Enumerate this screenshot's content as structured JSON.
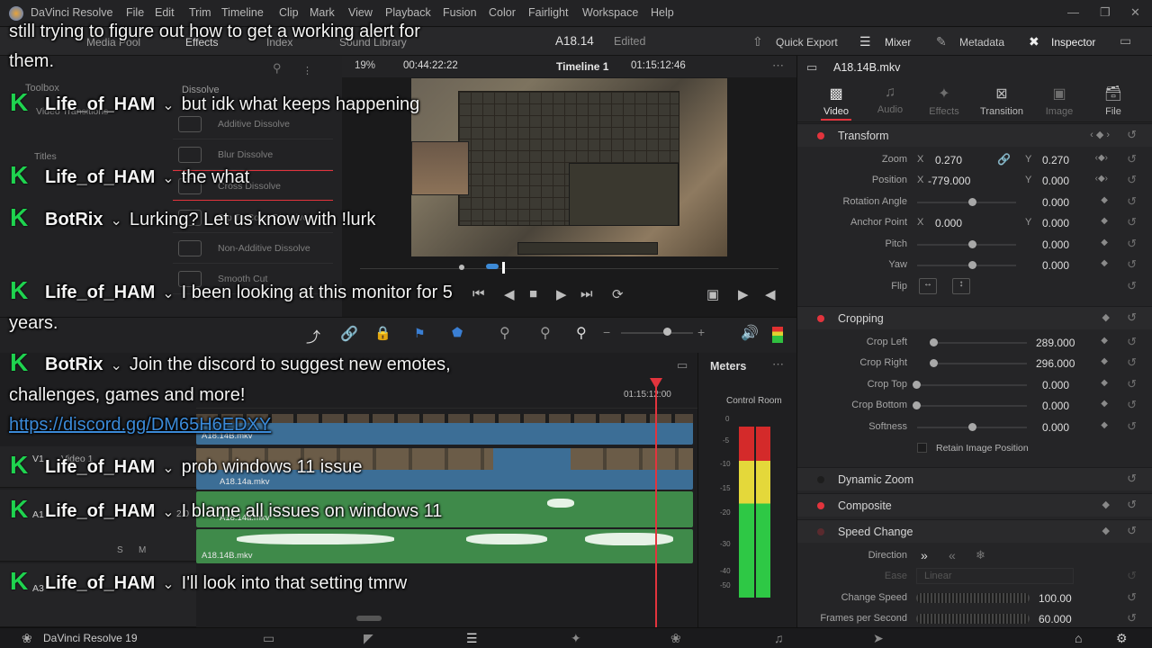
{
  "menu": [
    "DaVinci Resolve",
    "File",
    "Edit",
    "Trim",
    "Timeline",
    "Clip",
    "Mark",
    "View",
    "Playback",
    "Fusion",
    "Color",
    "Fairlight",
    "Workspace",
    "Help"
  ],
  "toolbar": {
    "media_pool": "Media Pool",
    "effects": "Effects",
    "index": "Index",
    "sound_library": "Sound Library",
    "project_name": "A18.14",
    "edited": "Edited",
    "quick_export": "Quick Export",
    "mixer": "Mixer",
    "metadata": "Metadata",
    "inspector": "Inspector"
  },
  "viewer": {
    "zoom": "19%",
    "timecode_left": "00:44:22:22",
    "timeline_name": "Timeline 1",
    "timecode_right": "01:15:12:46",
    "clip_name": "A18.14B.mkv"
  },
  "left_panel": {
    "toolbox": "Toolbox",
    "video_transitions": "Video Transitions",
    "titles": "Titles",
    "dissolve_header": "Dissolve",
    "effects": [
      "Additive Dissolve",
      "Blur Dissolve",
      "Cross Dissolve",
      "Dip To Color Dissolve",
      "Non-Additive Dissolve",
      "Smooth Cut"
    ]
  },
  "timeline": {
    "ruler_tc": "01:15:12:00",
    "v1": "V1",
    "video1": "Video 1",
    "a1": "A1",
    "a1_level": "2.0",
    "clip_v": "A18.14B.mkv",
    "clip_v2": "A18.14a.mkv",
    "clip_a1": "A18.14a.mkv",
    "clip_a2": "A18.14B.mkv",
    "a3": "A3",
    "m_btn": "M",
    "s_btn": "S"
  },
  "meters": {
    "title": "Meters",
    "control_room": "Control Room",
    "scale": [
      "0",
      "-5",
      "-10",
      "-15",
      "-20",
      "-30",
      "-40",
      "-50"
    ]
  },
  "inspector": {
    "clip_title": "A18.14B.mkv",
    "tabs": [
      "Video",
      "Audio",
      "Effects",
      "Transition",
      "Image",
      "File"
    ],
    "transform": {
      "title": "Transform",
      "zoom_label": "Zoom",
      "zoom_x": "0.270",
      "zoom_y": "0.270",
      "position_label": "Position",
      "pos_x": "-779.000",
      "pos_y": "0.000",
      "rotation_label": "Rotation Angle",
      "rotation": "0.000",
      "anchor_label": "Anchor Point",
      "anchor_x": "0.000",
      "anchor_y": "0.000",
      "pitch_label": "Pitch",
      "pitch": "0.000",
      "yaw_label": "Yaw",
      "yaw": "0.000",
      "flip_label": "Flip",
      "x": "X",
      "y": "Y"
    },
    "cropping": {
      "title": "Cropping",
      "left_label": "Crop Left",
      "left": "289.000",
      "right_label": "Crop Right",
      "right": "296.000",
      "top_label": "Crop Top",
      "top": "0.000",
      "bottom_label": "Crop Bottom",
      "bottom": "0.000",
      "soft_label": "Softness",
      "soft": "0.000",
      "retain": "Retain Image Position"
    },
    "dynamic_zoom": "Dynamic Zoom",
    "composite": "Composite",
    "speed": {
      "title": "Speed Change",
      "direction_label": "Direction",
      "ease_label": "Ease",
      "ease_value": "Linear",
      "change_label": "Change Speed",
      "change_value": "100.00",
      "fps_label": "Frames per Second",
      "fps_value": "60.000"
    }
  },
  "statusbar": {
    "app": "DaVinci Resolve 19"
  },
  "chat": [
    {
      "user": "",
      "text": "still trying to figure out how to get a working alert for them."
    },
    {
      "user": "Life_of_HAM",
      "text": "but idk what keeps happening"
    },
    {
      "user": "Life_of_HAM",
      "text": "the what"
    },
    {
      "user": "BotRix",
      "text": "Lurking? Let us know with !lurk"
    },
    {
      "user": "Life_of_HAM",
      "text": "I been looking at this monitor for 5 years."
    },
    {
      "user": "BotRix",
      "text": "Join the discord to suggest new emotes, challenges, games and more!",
      "link": "https://discord.gg/DM65H6EDXY"
    },
    {
      "user": "Life_of_HAM",
      "text": "prob windows 11 issue"
    },
    {
      "user": "Life_of_HAM",
      "text": "I blame all issues on windows 11"
    },
    {
      "user": "Life_of_HAM",
      "text": "I'll look into that setting tmrw"
    }
  ],
  "colors": {
    "accent_red": "#e2343d",
    "chat_green": "#1fd34f",
    "clip_blue": "#3c6e96",
    "clip_green": "#3f8a4a"
  }
}
